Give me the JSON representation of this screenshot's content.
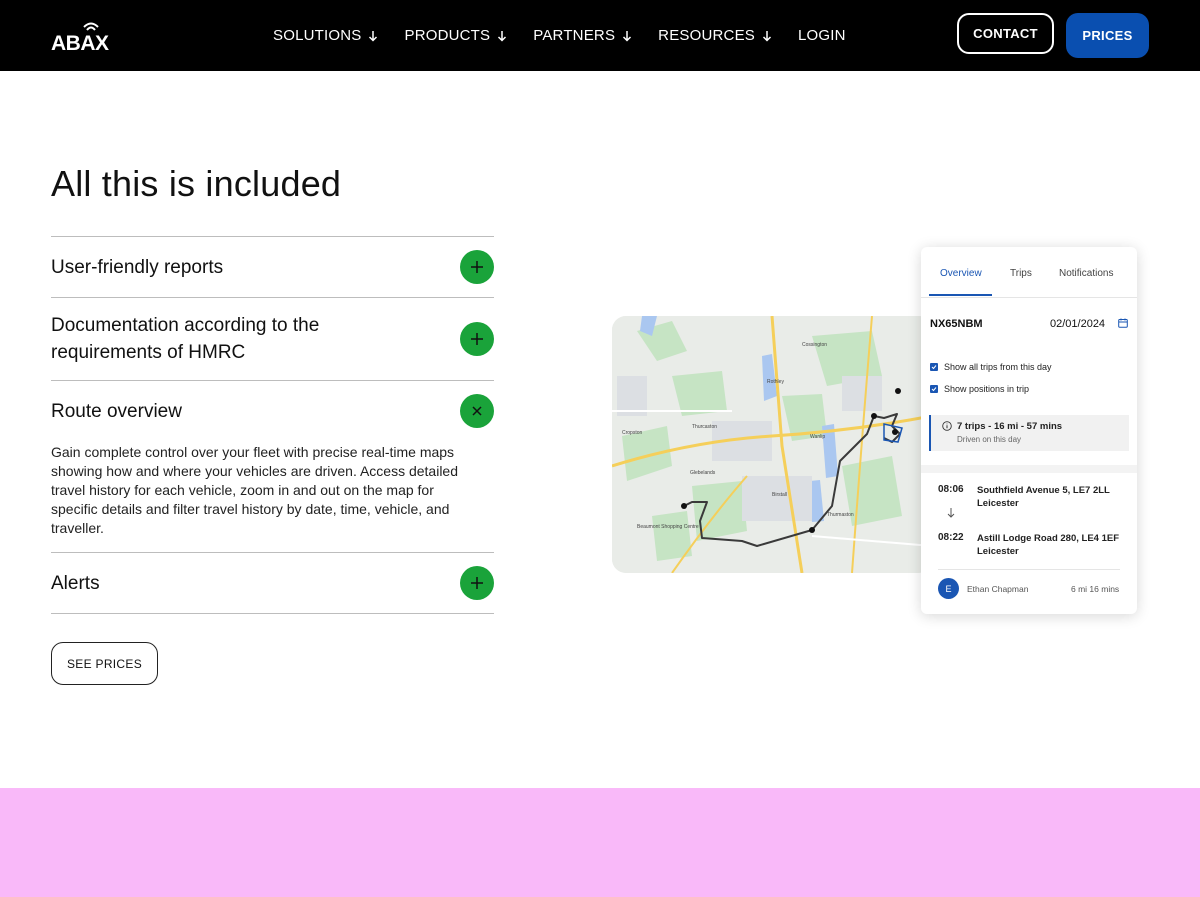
{
  "header": {
    "logo_text": "ABAX",
    "nav": [
      {
        "label": "SOLUTIONS",
        "icon": "arrow-down-icon"
      },
      {
        "label": "PRODUCTS",
        "icon": "arrow-down-icon"
      },
      {
        "label": "PARTNERS",
        "icon": "arrow-down-icon"
      },
      {
        "label": "RESOURCES",
        "icon": "arrow-down-icon"
      },
      {
        "label": "LOGIN"
      }
    ],
    "contact_label": "CONTACT",
    "prices_label": "PRICES"
  },
  "main": {
    "title": "All this is included",
    "accordion": [
      {
        "label": "User-friendly reports",
        "state": "collapsed",
        "icon": "plus-icon"
      },
      {
        "label": "Documentation according to the requirements of HMRC",
        "state": "collapsed",
        "icon": "plus-icon"
      },
      {
        "label": "Route overview",
        "state": "expanded",
        "icon": "close-icon",
        "body": "Gain complete control over your fleet with precise real-time maps showing how and where your vehicles are driven. Access detailed travel history for each vehicle, zoom in and out on the map for specific details and filter travel history by date, time, vehicle, and traveller."
      },
      {
        "label": "Alerts",
        "state": "collapsed",
        "icon": "plus-icon"
      }
    ],
    "see_prices_label": "SEE PRICES"
  },
  "map": {
    "labels": [
      "Rothley",
      "Thurcaston",
      "Wanlip",
      "Birstall",
      "Glebelands",
      "Thurmaston",
      "Cropston",
      "Cossington",
      "Beaumont Shopping Centre"
    ]
  },
  "card": {
    "tabs": [
      "Overview",
      "Trips",
      "Notifications"
    ],
    "active_tab": "Overview",
    "plate": "NX65NBM",
    "date": "02/01/2024",
    "checks": [
      "Show all trips from this day",
      "Show positions in trip"
    ],
    "summary_title": "7 trips - 16 mi - 57 mins",
    "summary_sub": "Driven on this day",
    "trip": {
      "start_time": "08:06",
      "start_addr": "Southfield Avenue 5, LE7 2LL Leicester",
      "end_time": "08:22",
      "end_addr": "Astill Lodge Road 280, LE4 1EF Leicester",
      "driver_initial": "E",
      "driver": "Ethan Chapman",
      "distance": "6 mi 16 mins"
    }
  },
  "colors": {
    "header_bg": "#000000",
    "accent_blue": "#0a4fb0",
    "green_button": "#1aa33a",
    "pink_band": "#f9b9f9"
  }
}
